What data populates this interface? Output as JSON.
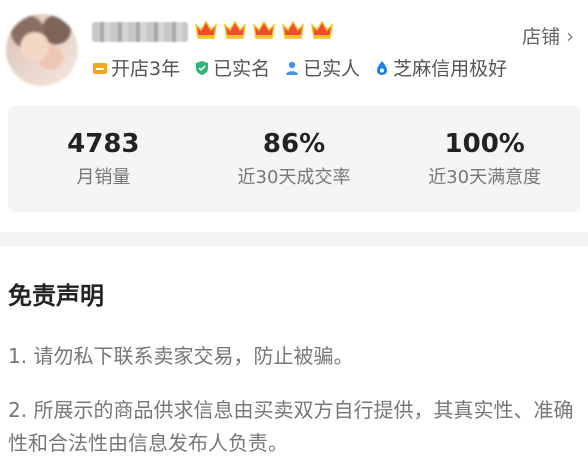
{
  "shop": {
    "link_label": "店铺",
    "badges": [
      {
        "icon": "shop-years-icon",
        "label": "开店3年",
        "color": "#f6a623"
      },
      {
        "icon": "verified-name-icon",
        "label": "已实名",
        "color": "#2bb673"
      },
      {
        "icon": "verified-person-icon",
        "label": "已实人",
        "color": "#4a8ff0"
      },
      {
        "icon": "sesame-credit-icon",
        "label": "芝麻信用极好",
        "color": "#1f7fe8"
      }
    ],
    "crown_count": 5,
    "crown_color": "#f24b2e"
  },
  "stats": [
    {
      "value": "4783",
      "label": "月销量"
    },
    {
      "value": "86%",
      "label": "近30天成交率"
    },
    {
      "value": "100%",
      "label": "近30天满意度"
    }
  ],
  "disclaimer": {
    "title": "免责声明",
    "items": [
      "1. 请勿私下联系卖家交易，防止被骗。",
      "2. 所展示的商品供求信息由买卖双方自行提供，其真实性、准确性和合法性由信息发布人负责。"
    ]
  }
}
